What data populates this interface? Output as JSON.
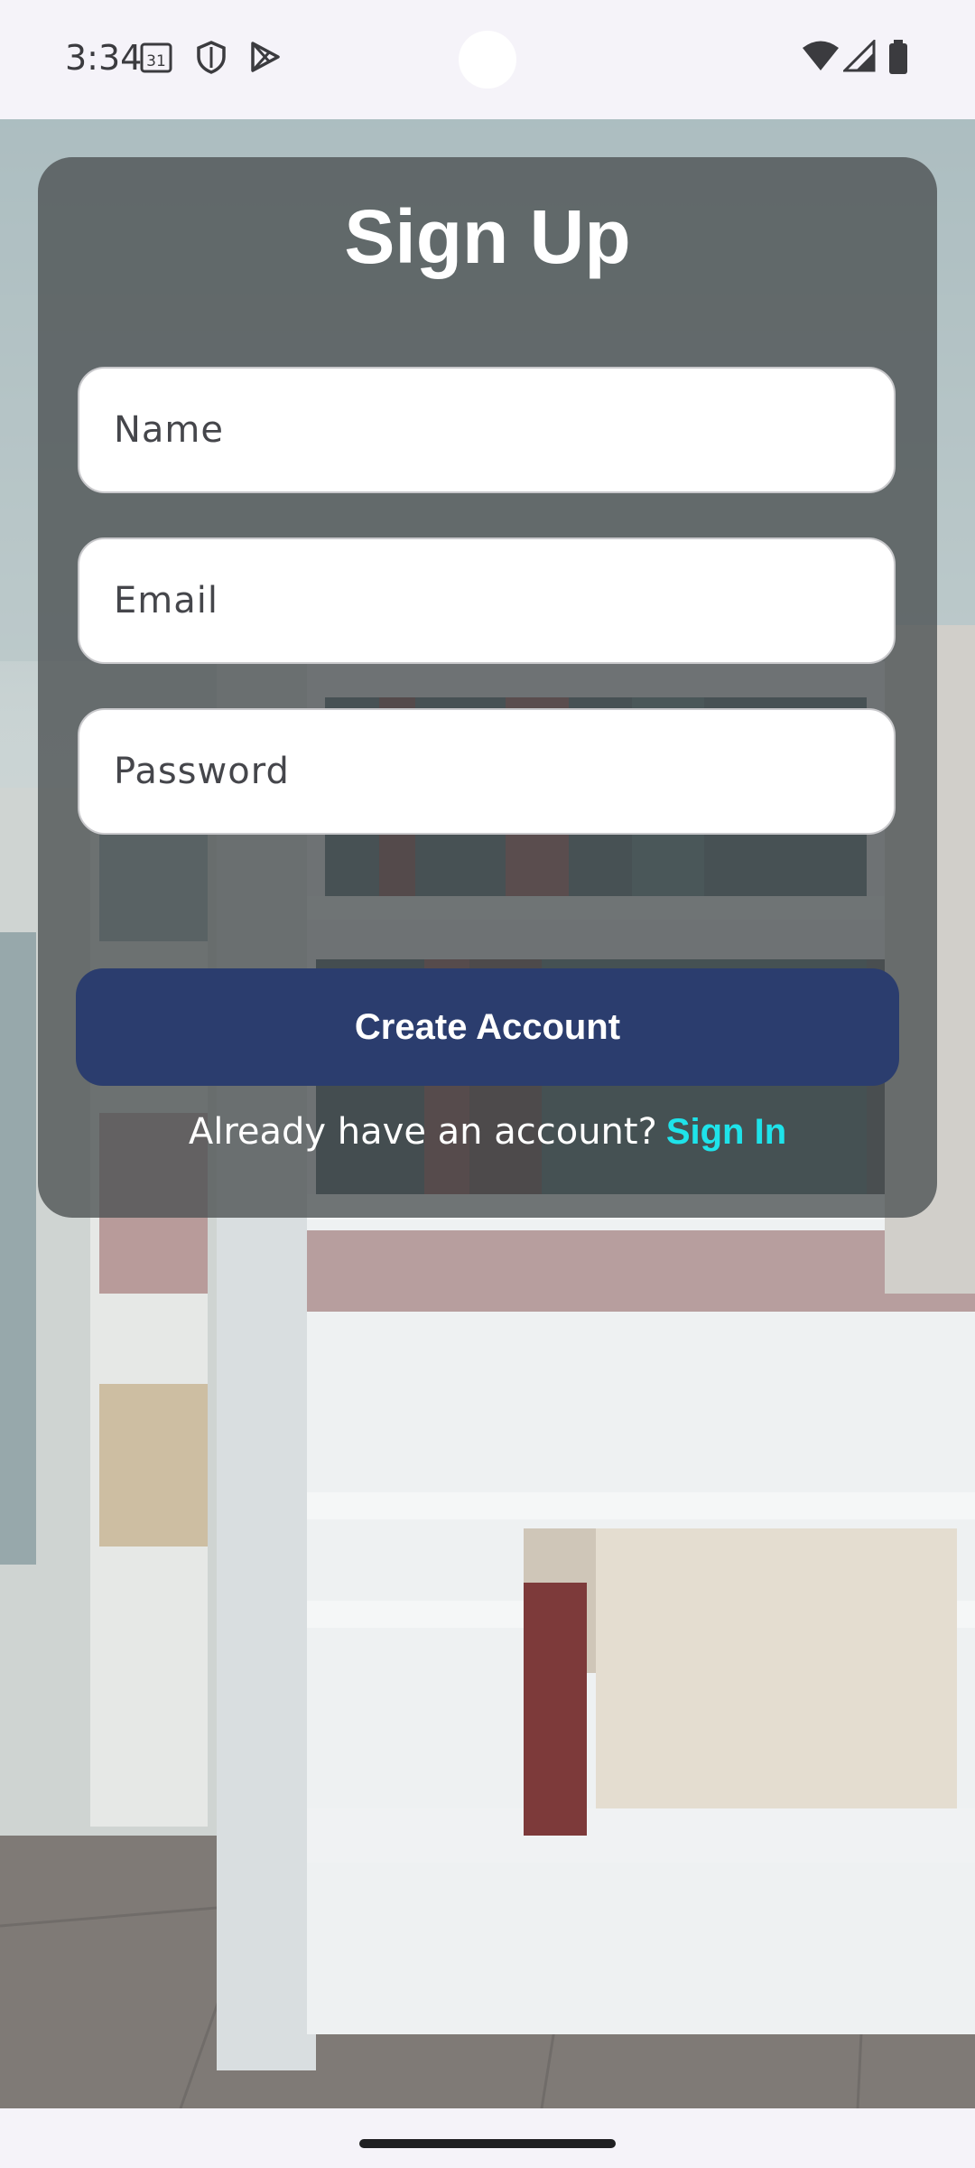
{
  "status_bar": {
    "time": "3:34",
    "calendar_badge": "31",
    "icons": [
      "calendar-icon",
      "shield-icon",
      "play-store-icon",
      "wifi-icon",
      "signal-icon",
      "battery-icon"
    ]
  },
  "signup": {
    "title": "Sign Up",
    "name_placeholder": "Name",
    "email_placeholder": "Email",
    "password_placeholder": "Password",
    "create_button": "Create Account",
    "have_account_text": "Already have an account?",
    "sign_in_link": "Sign In"
  },
  "colors": {
    "button": "#2b3d6e",
    "link": "#1ee3ea",
    "card_overlay": "rgba(78,82,84,0.80)"
  }
}
